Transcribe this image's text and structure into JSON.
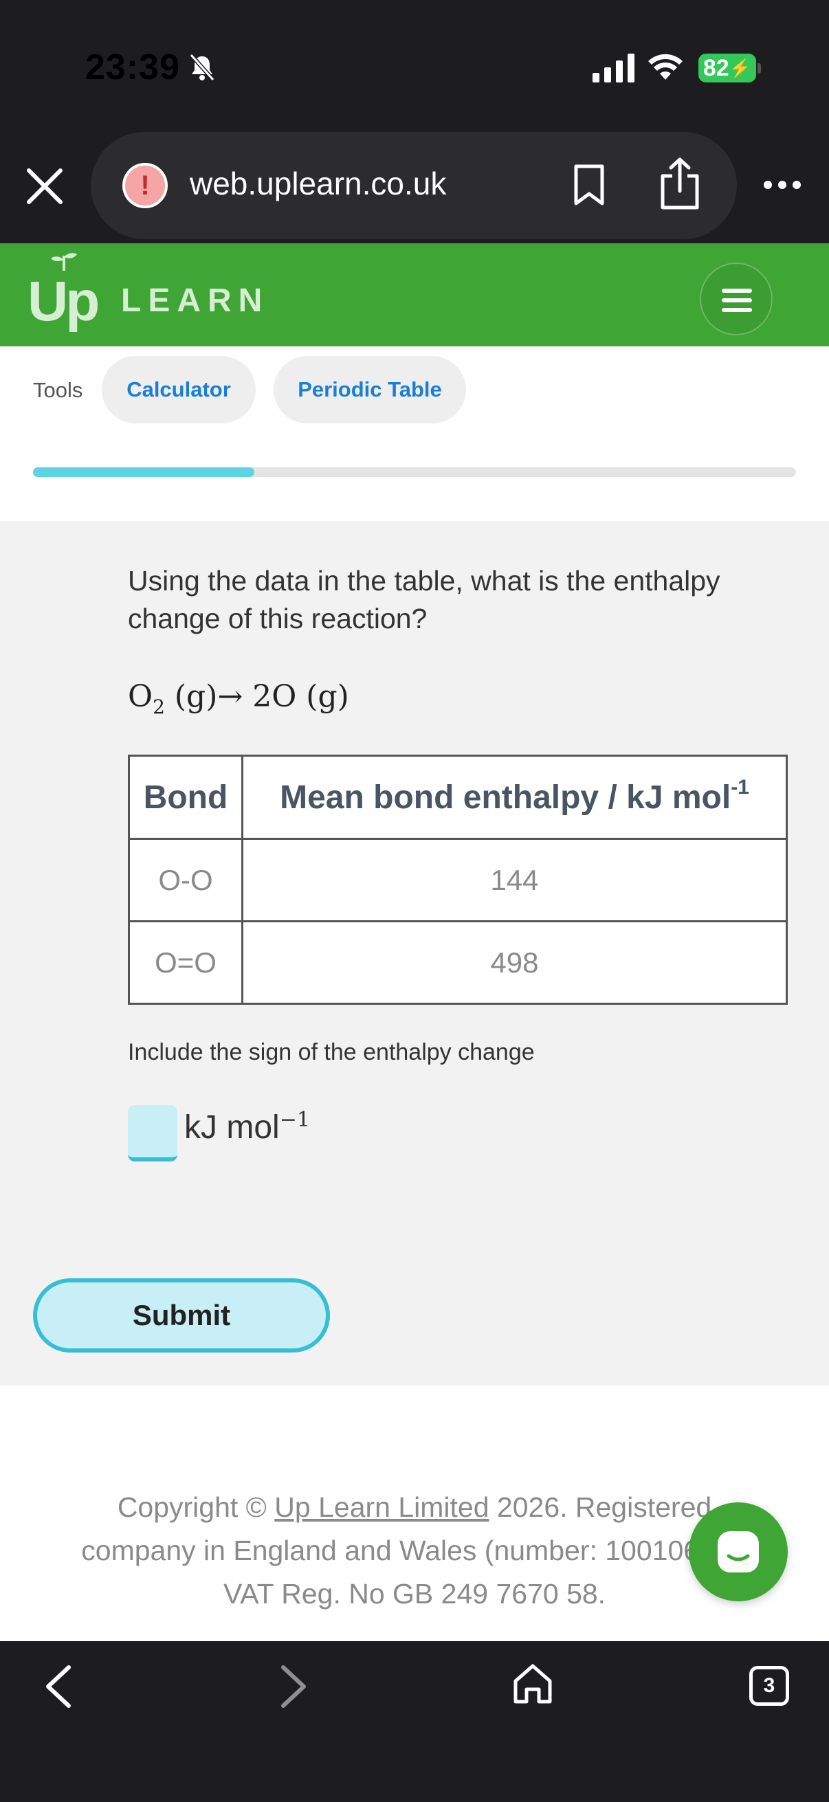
{
  "status_bar": {
    "time": "23:39",
    "battery": "82"
  },
  "browser": {
    "url": "web.uplearn.co.uk",
    "tab_count": "3"
  },
  "header": {
    "logo_text": "LEARN",
    "logo_mark": "Up"
  },
  "tools": {
    "label": "Tools",
    "buttons": [
      "Calculator",
      "Periodic Table"
    ],
    "progress_fraction": 0.29
  },
  "question": {
    "text": "Using the data in the table, what is the enthalpy change of this reaction?",
    "equation_left": "O",
    "equation_sub": "2",
    "equation_rest": " (g)→ 2O (g)",
    "table": {
      "headers": [
        "Bond",
        "Mean bond enthalpy / kJ mol"
      ],
      "header_superscript": "-1",
      "rows": [
        [
          "O-O",
          "144"
        ],
        [
          "O=O",
          "498"
        ]
      ]
    },
    "hint": "Include the sign of the enthalpy change",
    "answer_value": "",
    "unit": "kJ mol",
    "unit_superscript": "−1",
    "submit_label": "Submit"
  },
  "footer": {
    "copyright_prefix": "Copyright © ",
    "company_link": "Up Learn Limited",
    "copyright_suffix": " 2026. Registered company in England and Wales (number: 10010657). VAT Reg. No GB 249 7670 58."
  },
  "colors": {
    "brand_green": "#3fa535",
    "accent_cyan": "#36bfd4",
    "link_blue": "#1a7fd4"
  }
}
